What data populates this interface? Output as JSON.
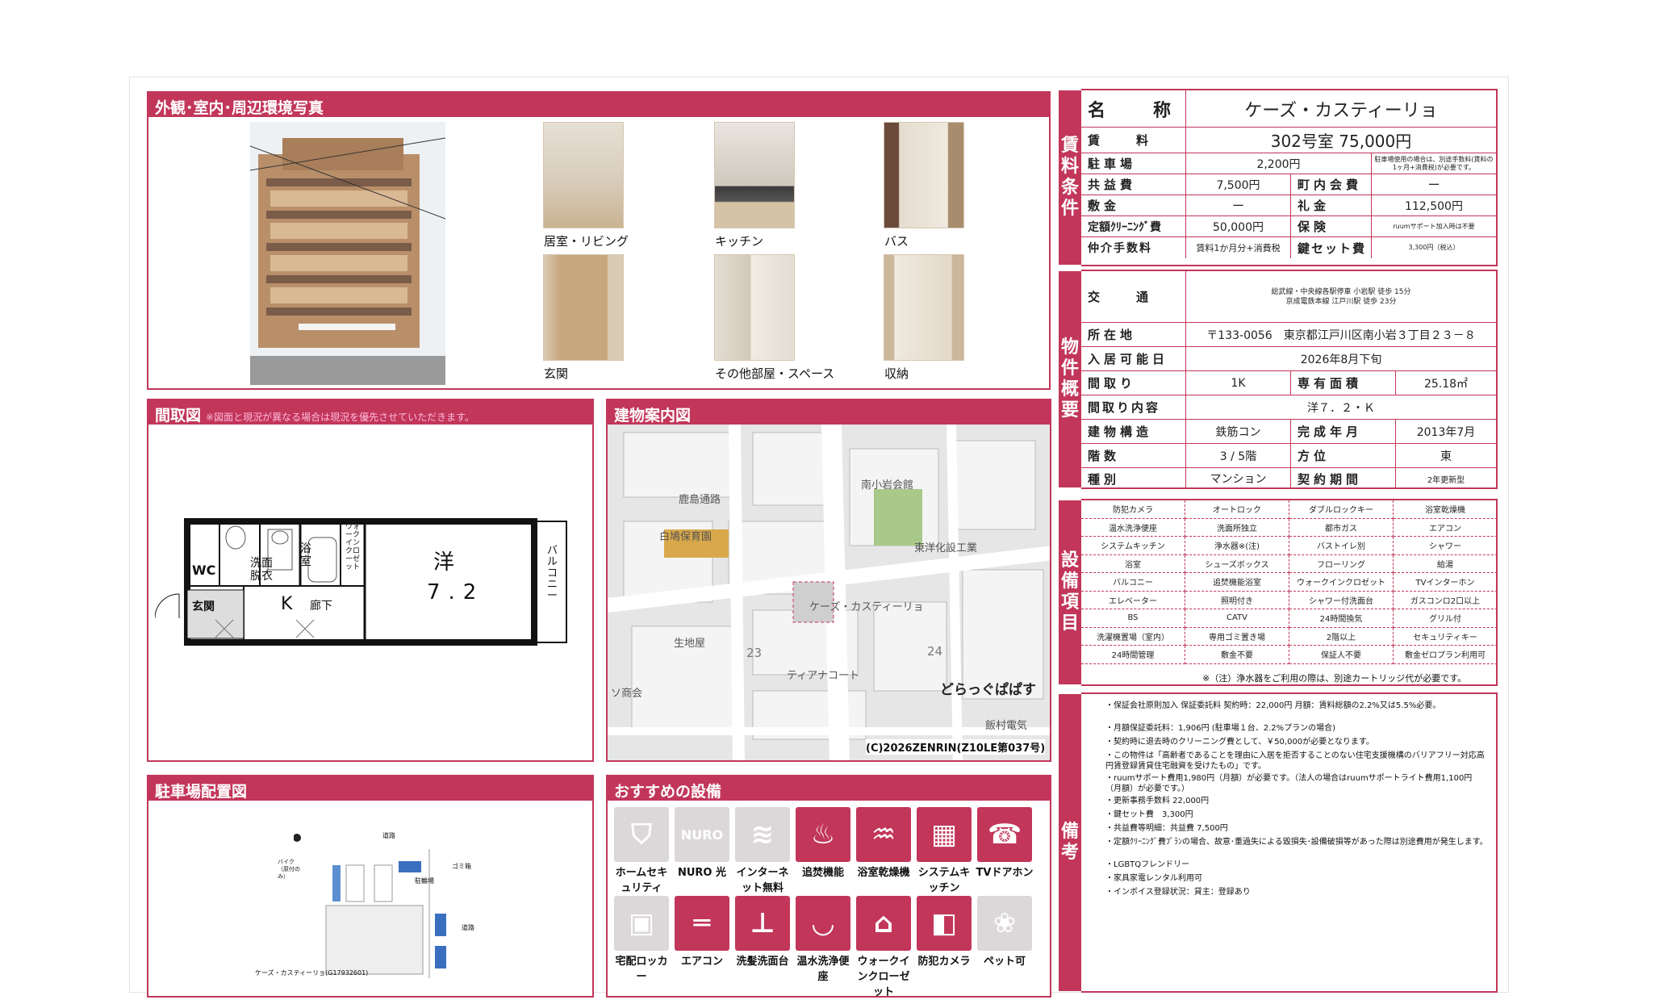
{
  "photos": {
    "header": "外観･室内･周辺環境写真",
    "captions": [
      "居室・リビング",
      "キッチン",
      "バス",
      "玄関",
      "その他部屋・スペース",
      "収納"
    ]
  },
  "floorplan": {
    "header": "間取図",
    "note": "※図面と現況が異なる場合は現況を優先させていただきます。",
    "labels": {
      "wc": "WC",
      "washroom": "洗面脱衣",
      "bath": "浴室",
      "closet": "ウォークインクローゼット",
      "room": "洋",
      "room_size": "7.2",
      "balcony": "バルコニー",
      "entrance": "玄関",
      "kitchen": "K",
      "corridor": "廊下"
    }
  },
  "map": {
    "header": "建物案内図",
    "labels": [
      "南小岩会館",
      "鹿島通路",
      "白鳩保育園",
      "東洋化設工業",
      "ケーズ・カスティーリョ",
      "生地屋",
      "23",
      "24",
      "ティアナコート",
      "どらっぐぱぱす",
      "ソ商会",
      "飯村電気"
    ],
    "copyright": "(C)2026ZENRIN(Z10LE第037号)"
  },
  "parking": {
    "header": "駐車場配置図",
    "labels": {
      "road_top": "道路",
      "road_right": "道路",
      "bike": "バイク（原付のみ）",
      "garbage": "ゴミ箱",
      "lot": "駐輪場",
      "caption": "ケーズ・カスティーリョ(G17932601)"
    }
  },
  "features": {
    "header": "おすすめの設備",
    "items": [
      {
        "label": "ホームセキュリティ",
        "icon": "home-security-icon",
        "on": false
      },
      {
        "label": "NURO 光",
        "icon": "nuro-icon",
        "on": false
      },
      {
        "label": "インターネット無料",
        "icon": "wifi-icon",
        "on": false
      },
      {
        "label": "追焚機能",
        "icon": "reheat-bath-icon",
        "on": true
      },
      {
        "label": "浴室乾燥機",
        "icon": "bathroom-dryer-icon",
        "on": true
      },
      {
        "label": "システムキッチン",
        "icon": "system-kitchen-icon",
        "on": true
      },
      {
        "label": "TVドアホン",
        "icon": "tv-intercom-icon",
        "on": true
      },
      {
        "label": "宅配ロッカー",
        "icon": "delivery-locker-icon",
        "on": false
      },
      {
        "label": "エアコン",
        "icon": "air-conditioner-icon",
        "on": true
      },
      {
        "label": "洗髪洗面台",
        "icon": "shampoo-vanity-icon",
        "on": true
      },
      {
        "label": "温水洗浄便座",
        "icon": "washlet-icon",
        "on": true
      },
      {
        "label": "ウォークインクローゼット",
        "icon": "walk-in-closet-icon",
        "on": true
      },
      {
        "label": "防犯カメラ",
        "icon": "security-camera-icon",
        "on": true
      },
      {
        "label": "ペット可",
        "icon": "pet-paw-icon",
        "on": false
      }
    ]
  },
  "rent": {
    "section": "賃料条件",
    "name_key": "名　　称",
    "name": "ケーズ・カスティーリョ",
    "rent_key": "賃　　料",
    "rent": "302号室 75,000円",
    "parking_key": "駐車場",
    "parking": "2,200円",
    "parking_note": "駐車場使用の場合は、別途手数料(賃料の1ヶ月+消費税)が必要です。",
    "common_key": "共益費",
    "common": "7,500円",
    "town_key": "町内会費",
    "town": "ー",
    "deposit_key": "敷金",
    "deposit": "ー",
    "key_money_key": "礼金",
    "key_money": "112,500円",
    "cleaning_key": "定額ｸﾘｰﾆﾝｸﾞ費",
    "cleaning": "50,000円",
    "insurance_key": "保険",
    "insurance": "ruumサポート加入時は不要",
    "brokerage_key": "仲介手数料",
    "brokerage": "賃料1か月分+消費税",
    "keyset_key": "鍵セット費",
    "keyset": "3,300円（税込）"
  },
  "overview": {
    "section": "物件概要",
    "access_key": "交　　通",
    "access1": "総武線・中央線各駅停車 小岩駅 徒歩 15分",
    "access2": "京成電鉄本線 江戸川駅 徒歩 23分",
    "address_key": "所在地",
    "address": "〒133-0056　東京都江戸川区南小岩３丁目２３－８",
    "movein_key": "入居可能日",
    "movein": "2026年8月下旬",
    "layout_key": "間取り",
    "layout": "1K",
    "area_key": "専有面積",
    "area": "25.18㎡",
    "layout_detail_key": "間取り内容",
    "layout_detail": "洋７．２・Ｋ",
    "structure_key": "建物構造",
    "structure": "鉄筋コン",
    "built_key": "完成年月",
    "built": "2013年7月",
    "floor_key": "階数",
    "floor": "3 / 5階",
    "direction_key": "方位",
    "direction": "東",
    "type_key": "種別",
    "type": "マンション",
    "contract_key": "契約期間",
    "contract": "2年更新型"
  },
  "equipment": {
    "section": "設備項目",
    "items": [
      "防犯カメラ",
      "オートロック",
      "ダブルロックキー",
      "浴室乾燥機",
      "温水洗浄便座",
      "洗面所独立",
      "都市ガス",
      "エアコン",
      "システムキッチン",
      "浄水器※(注)",
      "バストイレ別",
      "シャワー",
      "浴室",
      "シューズボックス",
      "フローリング",
      "給湯",
      "バルコニー",
      "追焚機能浴室",
      "ウォークインクロゼット",
      "TVインターホン",
      "エレベーター",
      "照明付き",
      "シャワー付洗面台",
      "ガスコンロ2口以上",
      "BS",
      "CATV",
      "24時間換気",
      "グリル付",
      "洗濯機置場（室内）",
      "専用ゴミ置き場",
      "2階以上",
      "セキュリティキー",
      "24時間管理",
      "敷金不要",
      "保証人不要",
      "敷金ゼロプラン利用可"
    ],
    "footnote": "※（注）浄水器をご利用の際は、別途カートリッジ代が必要です。"
  },
  "remarks": {
    "section": "備考",
    "lines": [
      "・保証会社原則加入 保証委託料 契約時：22,000円 月額：賃料総額の2.2%又は5.5%必要。",
      "・月額保証委託料：1,906円 (駐車場１台、2.2%プランの場合)",
      "・契約時に退去時のクリーニング費として、￥50,000が必要となります。",
      "・この物件は「高齢者であることを理由に入居を拒否することのない住宅支援機構のバリアフリー対応高円賃登録賃貸住宅融資を受けたもの」です。",
      "・ruumサポート費用1,980円（月額）が必要です。（法人の場合はruumサポートライト費用1,100円（月額）が必要です。）",
      "・更新事務手数料 22,000円",
      "・鍵セット費　3,300円",
      "・共益費等明細：共益費 7,500円",
      "・定額ｸﾘｰﾆﾝｸﾞ費ﾌﾟﾗﾝの場合、故意･重過失による毀損失･設備破損等があった際は別途費用が発生します。",
      "・LGBTQフレンドリー",
      "・家具家電レンタル利用可",
      "・インボイス登録状況：貸主：登録あり"
    ]
  }
}
